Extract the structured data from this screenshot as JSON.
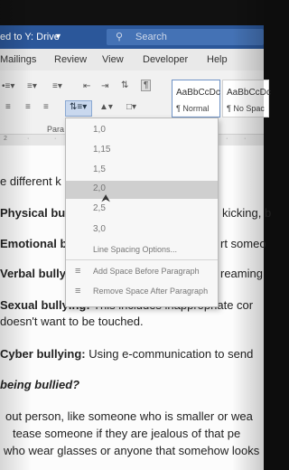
{
  "titlebar": {
    "save_status": "ed to Y: Drive",
    "search_placeholder": "Search"
  },
  "menu": [
    "Mailings",
    "Review",
    "View",
    "Developer",
    "Help"
  ],
  "ribbon": {
    "paragraph_group": "Para",
    "styles": [
      {
        "preview": "AaBbCcDc",
        "name": "¶ Normal"
      },
      {
        "preview": "AaBbCcDc",
        "name": "¶ No Spac"
      }
    ]
  },
  "line_spacing_menu": {
    "options": [
      "1,0",
      "1,15",
      "1,5",
      "2,0",
      "2,5",
      "3,0"
    ],
    "selected": "2,0",
    "more": "Line Spacing Options...",
    "add_before": "Add Space Before Paragraph",
    "remove_after": "Remove Space After Paragraph"
  },
  "document": {
    "lines": [
      {
        "bold": "",
        "text": "e different k"
      },
      {
        "bold": "Physical bull",
        "text": "",
        "right": "kicking, b"
      },
      {
        "bold": "Emotional b",
        "text": "",
        "right": "rt someo"
      },
      {
        "bold": "Verbal bully",
        "text": "",
        "right": "reaming"
      },
      {
        "bold": "Sexual bullying:",
        "text": " This includes inappropriate cor"
      },
      {
        "bold": "",
        "text": "doesn't want to be touched."
      },
      {
        "bold": "Cyber bullying:",
        "text": " Using e-communication to send"
      },
      {
        "italic": "being bullied?"
      },
      {
        "bold": "",
        "text": "out person, like someone who is smaller or wea"
      },
      {
        "bold": "",
        "text": "tease someone if they are jealous of that pe"
      },
      {
        "bold": "",
        "text": "who wear glasses or anyone that somehow looks"
      }
    ]
  }
}
